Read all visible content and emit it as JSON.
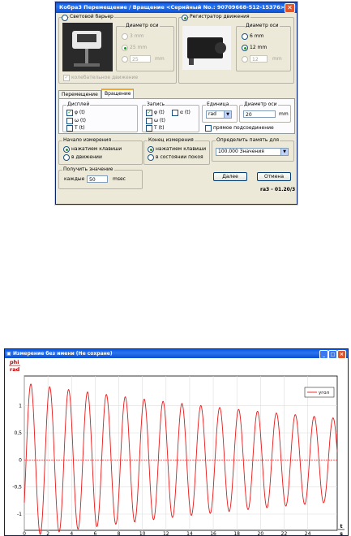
{
  "dialog": {
    "title": "Кобра3 Перемещение / Вращение  <Серийный No.: 90709668-512-15376>",
    "light_barrier": {
      "label": "Световой барьер",
      "diameter_label": "Диаметр оси",
      "options": [
        "3 mm",
        "25 mm",
        ""
      ],
      "custom_value": "25",
      "unit": "mm",
      "oscillating_label": "колебательное движение"
    },
    "motion_recorder": {
      "label": "Регистратор движения",
      "diameter_label": "Диаметр оси",
      "options": [
        "6 mm",
        "12 mm",
        ""
      ],
      "custom_value": "12",
      "unit": "mm"
    },
    "tabs": [
      "Перемещение",
      "Вращение"
    ],
    "display": {
      "label": "Дисплей",
      "items": [
        "φ (t)",
        "ω (t)",
        "T (t)"
      ]
    },
    "record": {
      "label": "Запись",
      "items": [
        "φ (t)",
        "α (t)",
        "ω (t)",
        "T (t)"
      ]
    },
    "unit": {
      "label": "Единица",
      "value": "rad"
    },
    "axis_diameter": {
      "label": "Диаметр оси",
      "value": "20",
      "unit": "mm"
    },
    "direct_connection": "прямое подсоединение",
    "start": {
      "label": "Начало измерения",
      "options": [
        "нажатием клавиши",
        "в движении"
      ]
    },
    "end": {
      "label": "Конец измерения",
      "options": [
        "нажатием клавиши",
        "в состоянии покоя"
      ]
    },
    "memory": {
      "label": "Определить память для",
      "value": "100.000 Значения"
    },
    "get_value": {
      "label": "Получить значение",
      "each": "каждые",
      "value": "50",
      "unit": "msec"
    },
    "next_button": "Далее",
    "cancel_button": "Отмена",
    "version": "ra3 - 01.20/3"
  },
  "chart_window": {
    "title": "Измерение без имени (Не сохране)",
    "controls": [
      "_",
      "□",
      "×"
    ]
  },
  "chart_data": {
    "type": "line",
    "ylabel_top": "phi",
    "ylabel_bottom": "rad",
    "xlabel_top": "t",
    "xlabel_bottom": "s",
    "xlim": [
      0,
      26.5
    ],
    "ylim": [
      -1.3,
      1.55
    ],
    "x_ticks": [
      "0",
      "2",
      "4",
      "6",
      "8",
      "10",
      "12",
      "14",
      "16",
      "18",
      "20",
      "22",
      "24"
    ],
    "y_ticks": [
      "1",
      "0,5",
      "0",
      "-0,5",
      "-1"
    ],
    "legend": "угол",
    "legend_position": "top-right",
    "series": [
      {
        "name": "угол",
        "color": "#e81818",
        "amplitude_start": 1.42,
        "amplitude_end": 0.77,
        "period_s": 1.6,
        "duration_s": 26.5
      }
    ],
    "grid": true
  }
}
